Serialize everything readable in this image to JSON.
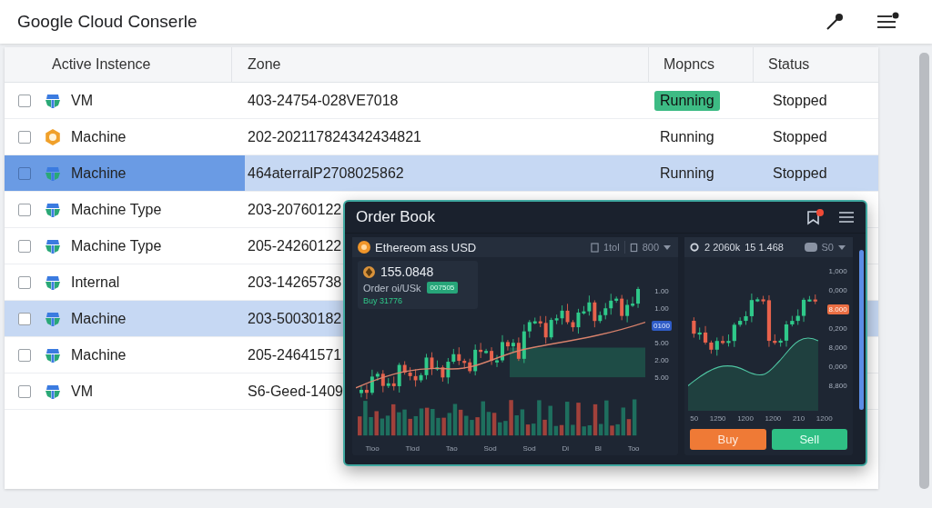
{
  "header": {
    "title": "Google Cloud Conserle",
    "notification": true
  },
  "table": {
    "columns": [
      "Active Instence",
      "Zone",
      "Mopncs",
      "Status"
    ],
    "rows": [
      {
        "kind": "compute",
        "name": "VM",
        "zone": "403-24754-028VE7018",
        "metrics": "Running",
        "metrics_badge": true,
        "status": "Stopped",
        "checked": false,
        "selected": false,
        "focused": false
      },
      {
        "kind": "coin",
        "name": "Machine",
        "zone": "202-202117824342434821",
        "metrics": "Running",
        "metrics_badge": false,
        "status": "Stopped",
        "checked": false,
        "selected": false,
        "focused": false
      },
      {
        "kind": "compute",
        "name": "Machine",
        "zone": "464aterralP2708025862",
        "metrics": "Running",
        "metrics_badge": false,
        "status": "Stopped",
        "checked": false,
        "selected": true,
        "focused": true
      },
      {
        "kind": "compute",
        "name": "Machine Type",
        "zone": "203-20760122",
        "checked": false,
        "selected": false,
        "focused": false
      },
      {
        "kind": "compute",
        "name": "Machine Type",
        "zone": "205-24260122",
        "checked": false,
        "selected": false,
        "focused": false
      },
      {
        "kind": "compute",
        "name": "Internal",
        "zone": "203-14265738",
        "checked": false,
        "selected": false,
        "focused": false
      },
      {
        "kind": "compute",
        "name": "Machine",
        "zone": "203-50030182",
        "checked": false,
        "selected": true,
        "focused": false
      },
      {
        "kind": "compute",
        "name": "Machine",
        "zone": "205-24641571",
        "checked": false,
        "selected": false,
        "focused": false
      },
      {
        "kind": "compute",
        "name": "VM",
        "zone": "S6-Geed-1409",
        "checked": false,
        "selected": false,
        "focused": false
      }
    ]
  },
  "order_book": {
    "title": "Order Book",
    "notification": true,
    "pair_panel": {
      "pair": "Ethereom ass USD",
      "interval": "1tol",
      "amount": "800",
      "price": "155.0848",
      "order_label": "Order oi/USk",
      "order_badge": "007505",
      "buy_line": "Buy 31776",
      "y_labels": [
        {
          "text": "1.00",
          "highlight": false
        },
        {
          "text": "1.00",
          "highlight": false
        },
        {
          "text": "0100",
          "highlight": true
        },
        {
          "text": "5.00",
          "highlight": false
        },
        {
          "text": "2.00",
          "highlight": false
        },
        {
          "text": "5.00",
          "highlight": false
        }
      ],
      "x_labels": [
        "Tioo",
        "Tlod",
        "Tao",
        "Sod",
        "Sod",
        "Di",
        "Bl",
        "Too"
      ]
    },
    "depth_panel": {
      "stat_1": "2 2060k",
      "stat_2": "15 1.468",
      "amount": "S0",
      "y_labels": [
        {
          "text": "1,000",
          "highlight": false
        },
        {
          "text": "0,000",
          "highlight": false
        },
        {
          "text": "8.000",
          "highlight": true
        },
        {
          "text": "0,200",
          "highlight": false
        },
        {
          "text": "8,000",
          "highlight": false
        },
        {
          "text": "0,000",
          "highlight": false
        },
        {
          "text": "8,800",
          "highlight": false
        }
      ],
      "x_labels": [
        "50",
        "1250",
        "1200",
        "1200",
        "210",
        "1200"
      ]
    },
    "buttons": [
      {
        "kind": "buy",
        "label": "Buy"
      },
      {
        "kind": "sell",
        "label": "Sell"
      }
    ]
  }
}
